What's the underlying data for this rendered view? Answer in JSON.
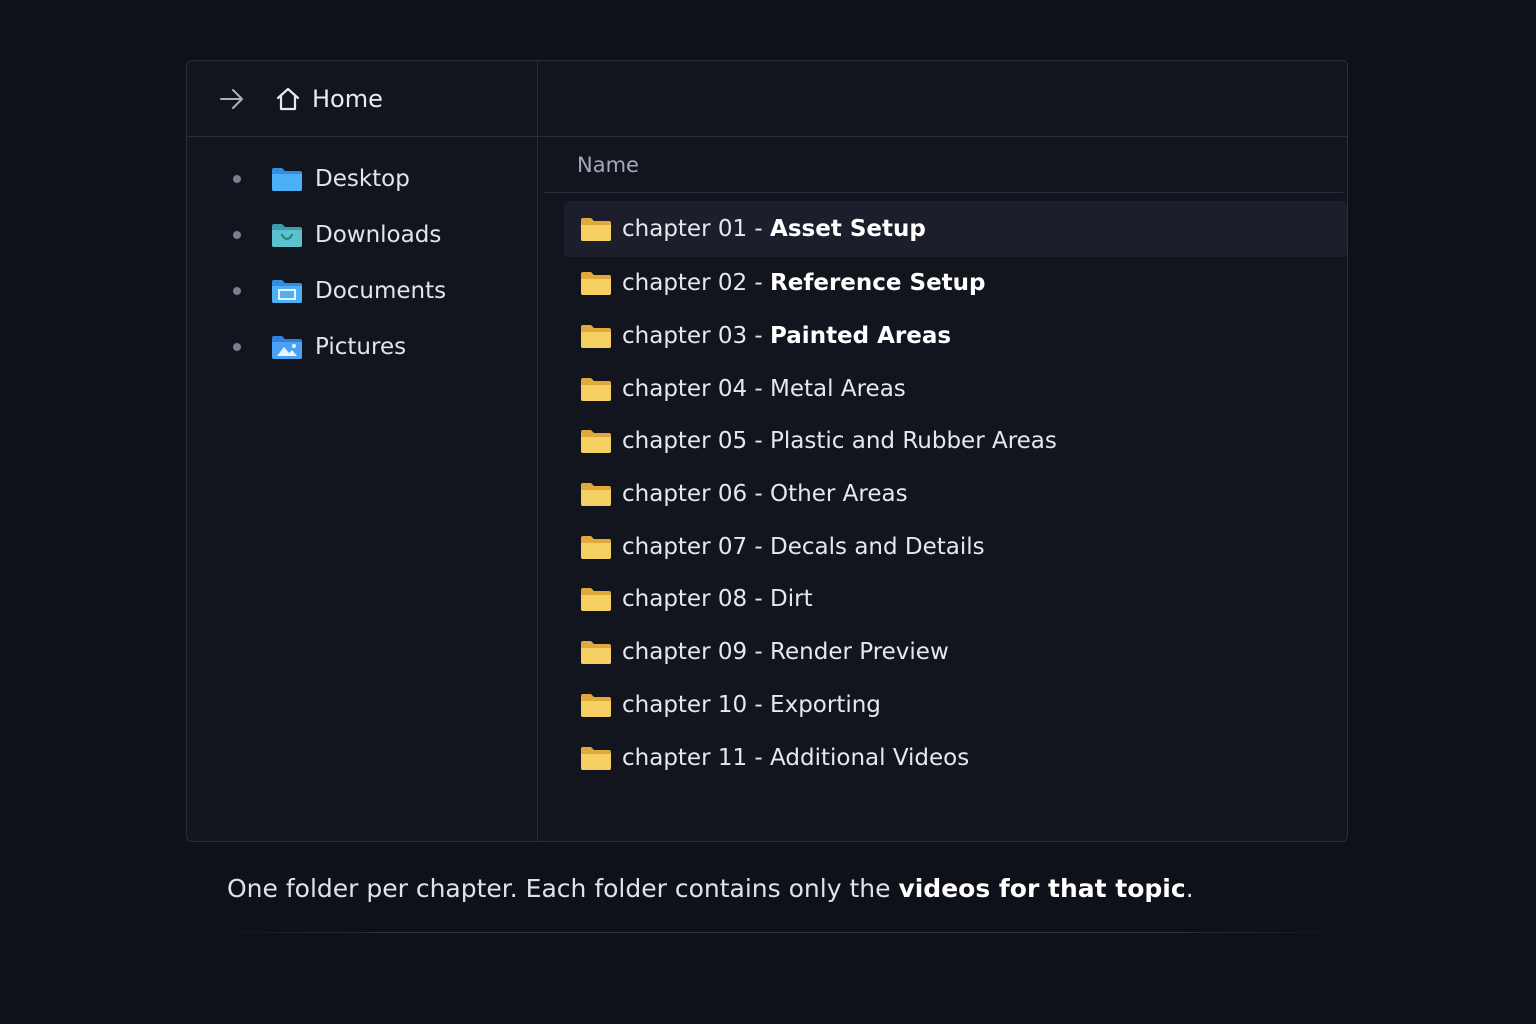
{
  "sidebar": {
    "home_label": "Home",
    "items": [
      {
        "label": "Desktop",
        "icon": "desktop-folder-icon"
      },
      {
        "label": "Downloads",
        "icon": "downloads-folder-icon"
      },
      {
        "label": "Documents",
        "icon": "documents-folder-icon"
      },
      {
        "label": "Pictures",
        "icon": "pictures-folder-icon"
      }
    ]
  },
  "main": {
    "column_name": "Name",
    "files": [
      {
        "prefix": "chapter 01 - ",
        "title": "Asset Setup"
      },
      {
        "prefix": "chapter 02 - ",
        "title": "Reference Setup"
      },
      {
        "prefix": "chapter 03 - ",
        "title": "Painted Areas"
      },
      {
        "prefix": "chapter 04 - ",
        "title": "Metal Areas"
      },
      {
        "prefix": "chapter 05 - ",
        "title": "Plastic and Rubber Areas"
      },
      {
        "prefix": "chapter 06 - ",
        "title": "Other Areas"
      },
      {
        "prefix": "chapter 07 - ",
        "title": "Decals and Details"
      },
      {
        "prefix": "chapter 08 - ",
        "title": "Dirt"
      },
      {
        "prefix": "chapter 09 - ",
        "title": "Render Preview"
      },
      {
        "prefix": "chapter 10 - ",
        "title": "Exporting"
      },
      {
        "prefix": "chapter 11 - ",
        "title": "Additional Videos"
      }
    ]
  },
  "caption": {
    "part1": "One folder per chapter. Each folder contains only the ",
    "strong": "videos for that topic",
    "part2": "."
  },
  "colors": {
    "background": "#0e1119",
    "panel": "#12151e",
    "folder_yellow": "#f3c656",
    "blue_folder": "#3aa0ef"
  }
}
